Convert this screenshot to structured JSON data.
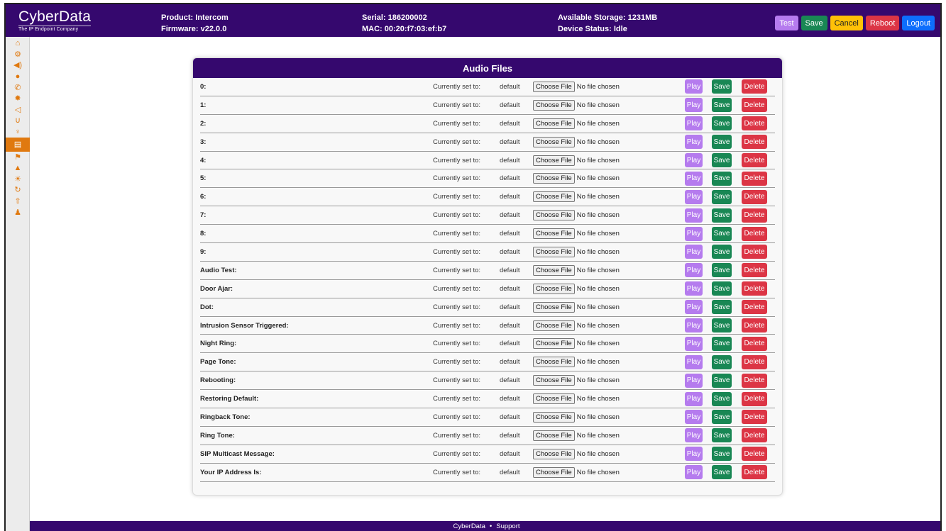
{
  "header": {
    "logo_main": "CyberData",
    "logo_tag": "The IP Endpoint Company",
    "product": "Product: Intercom",
    "firmware": "Firmware: v22.0.0",
    "serial": "Serial: 186200002",
    "mac": "MAC: 00:20:f7:03:ef:b7",
    "storage": "Available Storage: 1231MB",
    "status": "Device Status: Idle",
    "buttons": {
      "test": "Test",
      "save": "Save",
      "cancel": "Cancel",
      "reboot": "Reboot",
      "logout": "Logout"
    }
  },
  "sidebar": {
    "items": [
      {
        "icon": "home-icon",
        "glyph": "⌂"
      },
      {
        "icon": "gears-icon",
        "glyph": "⚙"
      },
      {
        "icon": "volume-icon",
        "glyph": "◀)"
      },
      {
        "icon": "globe-icon",
        "glyph": "●"
      },
      {
        "icon": "phone-icon",
        "glyph": "✆"
      },
      {
        "icon": "badge-icon",
        "glyph": "✸"
      },
      {
        "icon": "megaphone-icon",
        "glyph": "◁"
      },
      {
        "icon": "magnet-icon",
        "glyph": "∪"
      },
      {
        "icon": "lightbulb-icon",
        "glyph": "♀"
      },
      {
        "icon": "audio-file-icon",
        "glyph": "▤",
        "active": true
      },
      {
        "icon": "flag-icon",
        "glyph": "⚑"
      },
      {
        "icon": "lock-icon",
        "glyph": "▲"
      },
      {
        "icon": "sun-icon",
        "glyph": "☀"
      },
      {
        "icon": "refresh-icon",
        "glyph": "↻"
      },
      {
        "icon": "upload-icon",
        "glyph": "⇧"
      },
      {
        "icon": "user-icon",
        "glyph": "♟"
      }
    ]
  },
  "audio": {
    "title": "Audio Files",
    "currently_label": "Currently set to:",
    "choose_label": "Choose File",
    "no_file_label": "No file chosen",
    "play_label": "Play",
    "save_label": "Save",
    "delete_label": "Delete",
    "rows": [
      {
        "label": "0:",
        "value": "default"
      },
      {
        "label": "1:",
        "value": "default"
      },
      {
        "label": "2:",
        "value": "default"
      },
      {
        "label": "3:",
        "value": "default"
      },
      {
        "label": "4:",
        "value": "default"
      },
      {
        "label": "5:",
        "value": "default"
      },
      {
        "label": "6:",
        "value": "default"
      },
      {
        "label": "7:",
        "value": "default"
      },
      {
        "label": "8:",
        "value": "default"
      },
      {
        "label": "9:",
        "value": "default"
      },
      {
        "label": "Audio Test:",
        "value": "default"
      },
      {
        "label": "Door Ajar:",
        "value": "default"
      },
      {
        "label": "Dot:",
        "value": "default"
      },
      {
        "label": "Intrusion Sensor Triggered:",
        "value": "default"
      },
      {
        "label": "Night Ring:",
        "value": "default"
      },
      {
        "label": "Page Tone:",
        "value": "default"
      },
      {
        "label": "Rebooting:",
        "value": "default"
      },
      {
        "label": "Restoring Default:",
        "value": "default"
      },
      {
        "label": "Ringback Tone:",
        "value": "default"
      },
      {
        "label": "Ring Tone:",
        "value": "default"
      },
      {
        "label": "SIP Multicast Message:",
        "value": "default"
      },
      {
        "label": "Your IP Address Is:",
        "value": "default"
      }
    ]
  },
  "footer": {
    "link1": "CyberData",
    "separator": "•",
    "link2": "Support"
  },
  "colors": {
    "brand_purple": "#35086e",
    "accent_orange": "#e0790f",
    "play": "#b57bee",
    "save": "#198754",
    "cancel": "#ffc107",
    "delete": "#dc3545",
    "logout": "#0d6efd"
  }
}
